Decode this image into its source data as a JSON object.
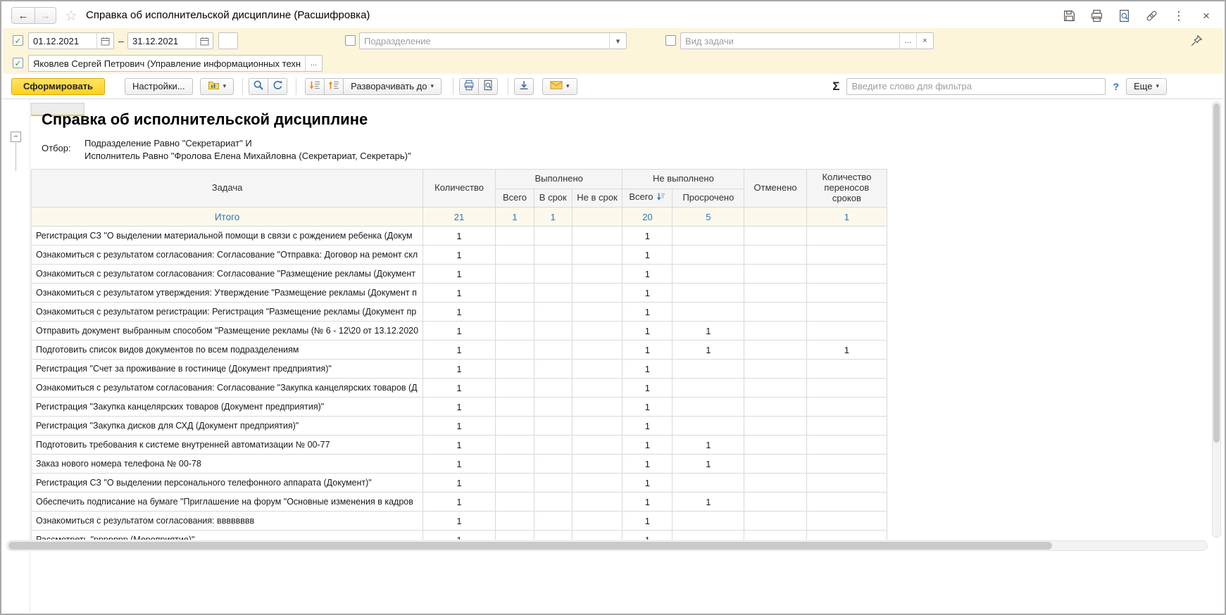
{
  "ui": {
    "caret": "▾",
    "dots": "...",
    "clear": "×",
    "check": "✓",
    "dash": "–",
    "back": "←",
    "forward": "→",
    "star": "☆",
    "more_dots": "⋮",
    "close": "×",
    "minus": "−"
  },
  "window": {
    "title": "Справка об исполнительской дисциплине (Расшифровка)"
  },
  "filter_bar": {
    "period": {
      "from": "01.12.2021",
      "to": "31.12.2021"
    },
    "department_placeholder": "Подразделение",
    "task_type_placeholder": "Вид задачи",
    "executor_value": "Яковлев Сергей Петрович (Управление информационных технол"
  },
  "toolbar": {
    "generate": "Сформировать",
    "settings": "Настройки...",
    "expand_to": "Разворачивать до",
    "sigma": "Σ",
    "filter_placeholder": "Введите слово для фильтра",
    "help": "?",
    "more": "Еще"
  },
  "report": {
    "title": "Справка об исполнительской дисциплине",
    "selection_label": "Отбор:",
    "selection_lines": [
      "Подразделение Равно \"Секретариат\" И",
      "Исполнитель Равно \"Фролова Елена Михайловна (Секретариат, Секретарь)\""
    ]
  },
  "table": {
    "headers": {
      "task": "Задача",
      "count": "Количество",
      "done_group": "Выполнено",
      "done_total": "Всего",
      "done_on_time": "В срок",
      "done_late": "Не в срок",
      "not_done_group": "Не выполнено",
      "not_done_total": "Всего",
      "overdue": "Просрочено",
      "cancelled": "Отменено",
      "reschedules": "Количество переносов сроков"
    },
    "totals": {
      "label": "Итого",
      "values": [
        "21",
        "1",
        "1",
        "",
        "20",
        "5",
        "",
        "1"
      ]
    },
    "rows": [
      {
        "task": "Регистрация СЗ \"О выделении материальной помощи в связи с рождением ребенка (Докум",
        "values": [
          "1",
          "",
          "",
          "",
          "1",
          "",
          "",
          ""
        ]
      },
      {
        "task": "Ознакомиться с результатом согласования: Согласование \"Отправка: Договор на ремонт скл",
        "values": [
          "1",
          "",
          "",
          "",
          "1",
          "",
          "",
          ""
        ]
      },
      {
        "task": "Ознакомиться с результатом согласования: Согласование \"Размещение рекламы (Документ",
        "values": [
          "1",
          "",
          "",
          "",
          "1",
          "",
          "",
          ""
        ]
      },
      {
        "task": "Ознакомиться с результатом утверждения: Утверждение \"Размещение рекламы (Документ п",
        "values": [
          "1",
          "",
          "",
          "",
          "1",
          "",
          "",
          ""
        ]
      },
      {
        "task": "Ознакомиться с результатом регистрации: Регистрация \"Размещение рекламы (Документ пр",
        "values": [
          "1",
          "",
          "",
          "",
          "1",
          "",
          "",
          ""
        ]
      },
      {
        "task": "Отправить документ выбранным способом \"Размещение рекламы (№ 6 - 12\\20 от 13.12.2020",
        "values": [
          "1",
          "",
          "",
          "",
          "1",
          "1",
          "",
          ""
        ]
      },
      {
        "task": "Подготовить список видов документов по всем подразделениям",
        "values": [
          "1",
          "",
          "",
          "",
          "1",
          "1",
          "",
          "1"
        ]
      },
      {
        "task": "Регистрация \"Счет за проживание в гостинице (Документ предприятия)\"",
        "values": [
          "1",
          "",
          "",
          "",
          "1",
          "",
          "",
          ""
        ]
      },
      {
        "task": "Ознакомиться с результатом согласования: Согласование \"Закупка канцелярских товаров (Д",
        "values": [
          "1",
          "",
          "",
          "",
          "1",
          "",
          "",
          ""
        ]
      },
      {
        "task": "Регистрация \"Закупка канцелярских товаров (Документ предприятия)\"",
        "values": [
          "1",
          "",
          "",
          "",
          "1",
          "",
          "",
          ""
        ]
      },
      {
        "task": "Регистрация \"Закупка дисков для СХД (Документ предприятия)\"",
        "values": [
          "1",
          "",
          "",
          "",
          "1",
          "",
          "",
          ""
        ]
      },
      {
        "task": "Подготовить требования к системе внутренней автоматизации № 00-77",
        "values": [
          "1",
          "",
          "",
          "",
          "1",
          "1",
          "",
          ""
        ]
      },
      {
        "task": "Заказ нового номера телефона № 00-78",
        "values": [
          "1",
          "",
          "",
          "",
          "1",
          "1",
          "",
          ""
        ]
      },
      {
        "task": "Регистрация СЗ \"О выделении персонального телефонного аппарата (Документ)\"",
        "values": [
          "1",
          "",
          "",
          "",
          "1",
          "",
          "",
          ""
        ]
      },
      {
        "task": "Обеспечить подписание на бумаге \"Приглашение на форум \"Основные изменения в кадров",
        "values": [
          "1",
          "",
          "",
          "",
          "1",
          "1",
          "",
          ""
        ]
      },
      {
        "task": "Ознакомиться с результатом согласования: вввввввв",
        "values": [
          "1",
          "",
          "",
          "",
          "1",
          "",
          "",
          ""
        ]
      },
      {
        "task": "Рассмотреть \"ррррррр (Мероприятие)\"",
        "values": [
          "1",
          "",
          "",
          "",
          "1",
          "",
          "",
          ""
        ]
      }
    ]
  }
}
